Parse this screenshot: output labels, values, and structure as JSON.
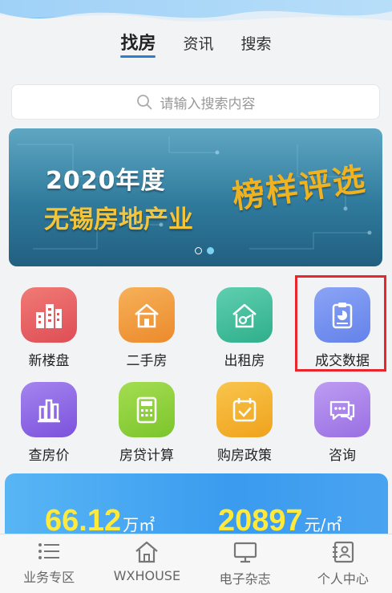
{
  "tabs": [
    {
      "label": "找房",
      "active": true
    },
    {
      "label": "资讯",
      "active": false
    },
    {
      "label": "搜索",
      "active": false
    }
  ],
  "search": {
    "placeholder": "请输入搜索内容",
    "icon": "search-icon"
  },
  "banner": {
    "line1": "2020年度",
    "line2": "无锡房地产业",
    "calligraphy": "榜样评选",
    "dots": 2,
    "active_dot": 1
  },
  "grid": [
    {
      "label": "新楼盘",
      "icon": "building-icon",
      "color": "#e85c5c"
    },
    {
      "label": "二手房",
      "icon": "house-icon",
      "color": "#f09a3a"
    },
    {
      "label": "出租房",
      "icon": "house-key-icon",
      "color": "#3dbb9a"
    },
    {
      "label": "成交数据",
      "icon": "clipboard-chart-icon",
      "color": "#6f8ef0",
      "highlighted": true
    },
    {
      "label": "查房价",
      "icon": "bar-chart-icon",
      "color": "#8e63e6"
    },
    {
      "label": "房贷计算",
      "icon": "calculator-icon",
      "color": "#8fd13a"
    },
    {
      "label": "购房政策",
      "icon": "calendar-check-icon",
      "color": "#f5b32b"
    },
    {
      "label": "咨询",
      "icon": "chat-icon",
      "color": "#a77ee8"
    }
  ],
  "stats": [
    {
      "value": "66.12",
      "unit": "万㎡"
    },
    {
      "value": "20897",
      "unit": "元/㎡"
    }
  ],
  "tabbar": [
    {
      "label": "业务专区",
      "icon": "list-icon"
    },
    {
      "label": "WXHOUSE",
      "icon": "home-icon"
    },
    {
      "label": "电子杂志",
      "icon": "monitor-icon"
    },
    {
      "label": "个人中心",
      "icon": "contact-card-icon"
    }
  ]
}
